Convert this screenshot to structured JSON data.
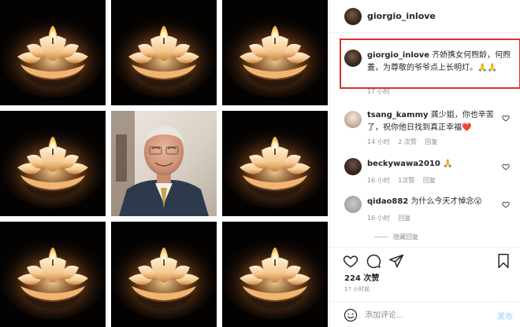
{
  "profile": {
    "username": "giorgio_inlove"
  },
  "caption": {
    "username": "giorgio_inlove",
    "text": "齐娇携女何煦龄，何煦蓋，为尊敬的爷爷点上长明灯。🙏🙏",
    "time": "17 小时"
  },
  "comments": [
    {
      "username": "tsang_kammy",
      "text": "龚少姐，你也辛苦了，祝你他日找到真正幸福❤️",
      "time": "14 小时",
      "likes": "2 次赞",
      "reply": "回复"
    },
    {
      "username": "beckywawa2010",
      "text": "🙏",
      "time": "16 小时",
      "likes": "1次赞",
      "reply": "回复"
    },
    {
      "username": "qidao882",
      "text": "为什么今天才悼念😮",
      "time": "16 小时",
      "reply": "回复"
    }
  ],
  "hide_replies": "隐藏回复",
  "likes_count": "224 次赞",
  "post_time": "17 小时前",
  "add_comment": {
    "placeholder": "添加评论...",
    "post_label": "发布"
  },
  "colors": {
    "highlight_border": "#d8312b",
    "post_button": "#b2dffc",
    "heart_red": "#ed4956"
  }
}
